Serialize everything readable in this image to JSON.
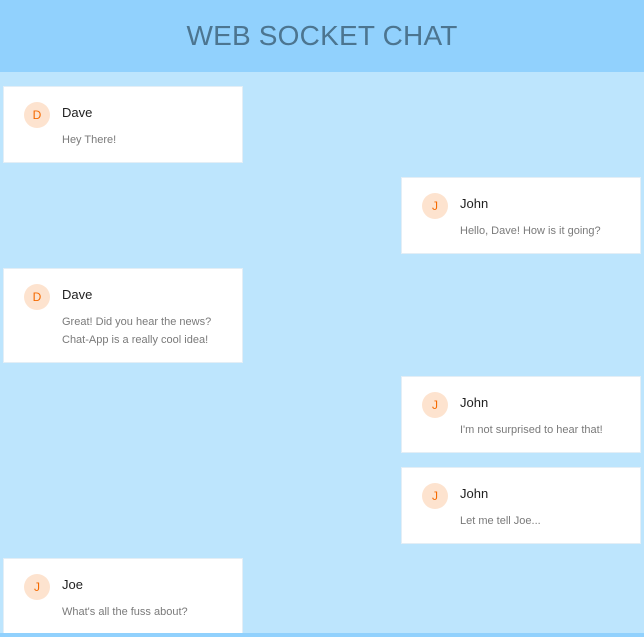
{
  "header": {
    "title": "WEB SOCKET CHAT"
  },
  "messages": [
    {
      "initial": "D",
      "name": "Dave",
      "text": "Hey There!"
    },
    {
      "initial": "J",
      "name": "John",
      "text": "Hello, Dave! How is it going?"
    },
    {
      "initial": "D",
      "name": "Dave",
      "text": "Great! Did you hear the news?\nChat-App is a really cool idea!"
    },
    {
      "initial": "J",
      "name": "John",
      "text": "I'm not surprised to hear that!"
    },
    {
      "initial": "J",
      "name": "John",
      "text": "Let me tell Joe..."
    },
    {
      "initial": "J",
      "name": "Joe",
      "text": "What's all the fuss about?"
    }
  ],
  "colors": {
    "background": "#bde5fd",
    "header": "#91d1fd",
    "avatar_bg": "#fde3cf",
    "avatar_fg": "#f56a00"
  }
}
